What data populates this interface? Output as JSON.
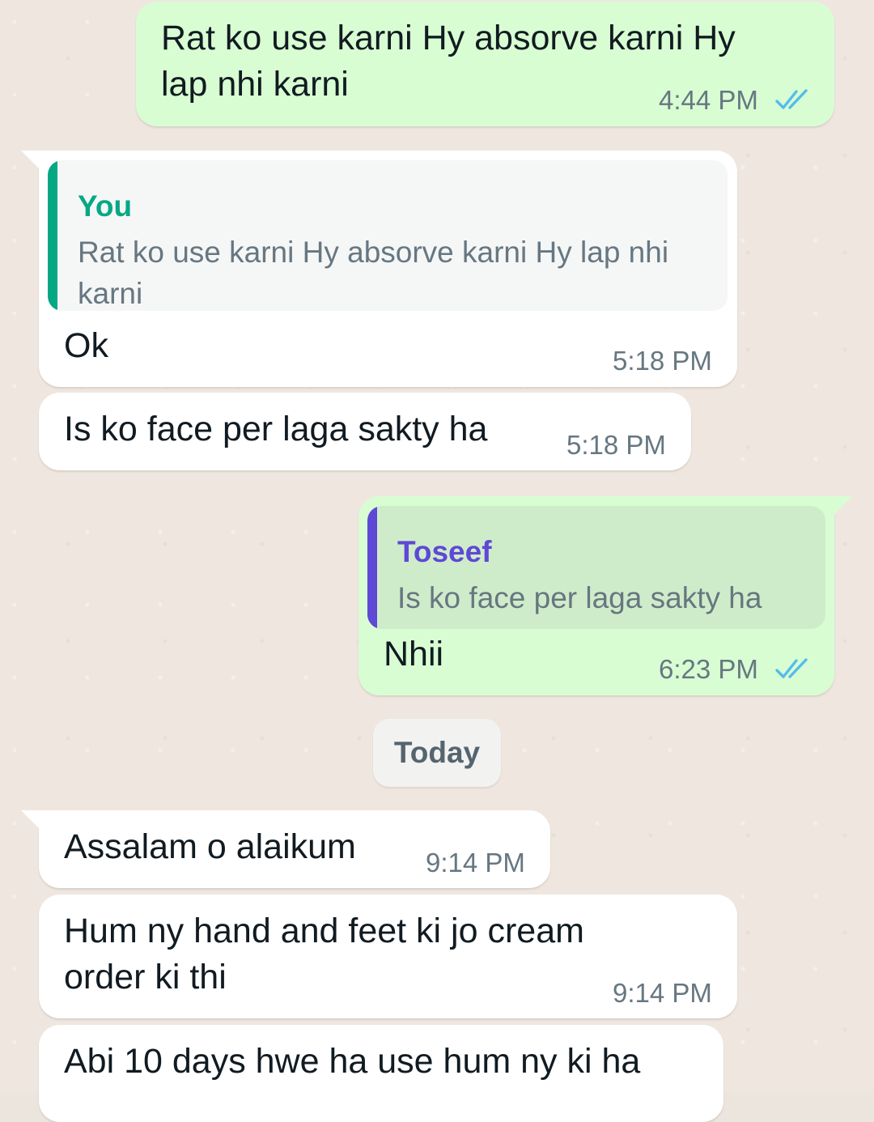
{
  "colors": {
    "outgoing_bubble": "#d9fdd3",
    "incoming_bubble": "#ffffff",
    "read_ticks": "#53bdeb",
    "quote_self_accent": "#06a884",
    "quote_contact_accent": "#5e48d6",
    "chat_background": "#efe7df"
  },
  "messages": [
    {
      "direction": "outgoing",
      "text": "Rat ko use karni Hy absorve karni Hy\nlap nhi karni",
      "time": "4:44 PM",
      "status_icon": "double-check-read-icon"
    },
    {
      "direction": "incoming",
      "quote": {
        "author": "You",
        "text": "Rat ko use karni Hy absorve karni Hy lap nhi karni"
      },
      "text": "Ok",
      "time": "5:18 PM"
    },
    {
      "direction": "incoming",
      "text": "Is ko face per laga sakty ha",
      "time": "5:18 PM"
    },
    {
      "direction": "outgoing",
      "quote": {
        "author": "Toseef",
        "text": "Is ko face per laga sakty ha"
      },
      "text": "Nhii",
      "time": "6:23 PM",
      "status_icon": "double-check-read-icon"
    },
    {
      "direction": "incoming",
      "text": "Assalam o alaikum",
      "time": "9:14 PM"
    },
    {
      "direction": "incoming",
      "text": "Hum ny hand and feet ki jo cream\norder ki thi",
      "time": "9:14 PM"
    },
    {
      "direction": "incoming",
      "text": "Abi 10 days hwe ha use hum ny ki ha",
      "time": ""
    }
  ],
  "date_divider": "Today"
}
